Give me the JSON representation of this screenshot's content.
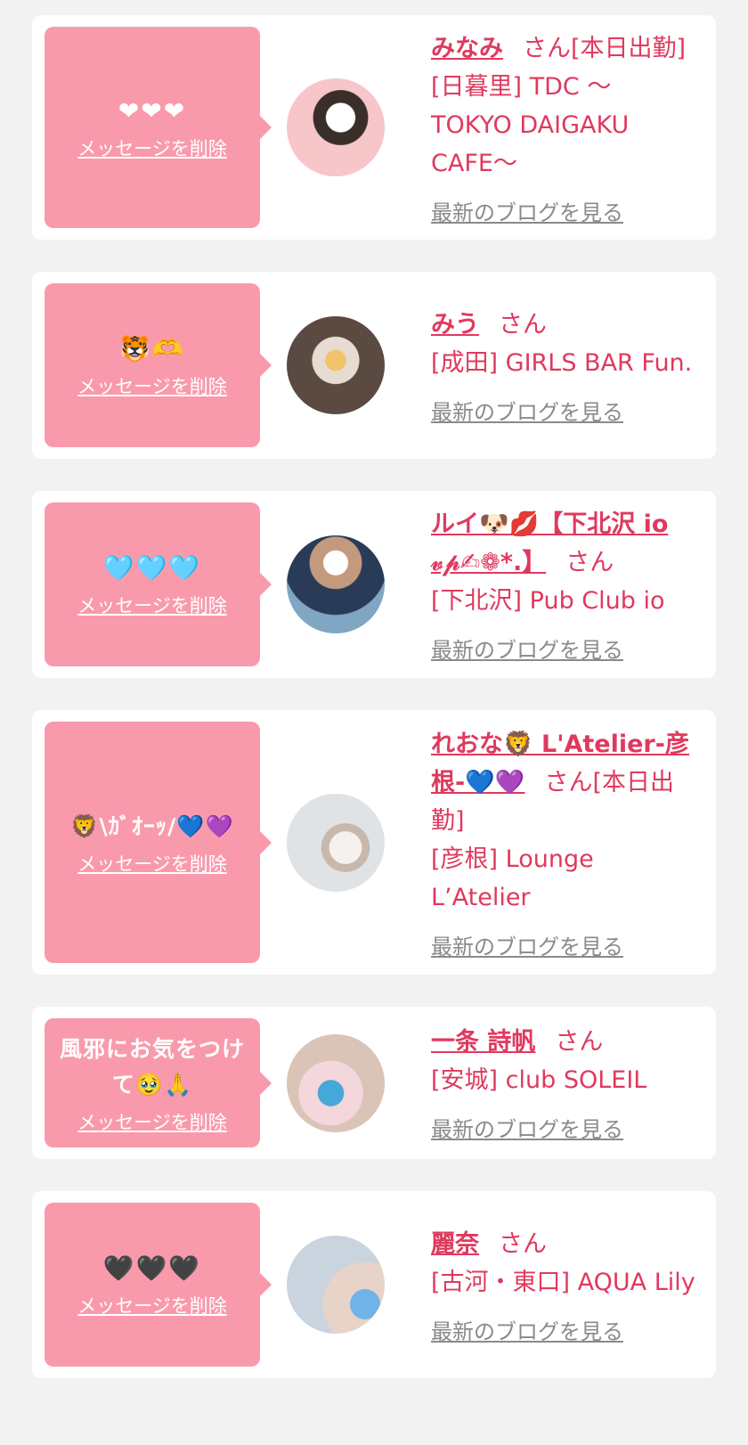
{
  "items": [
    {
      "message": "❤❤❤",
      "delete_label": "メッセージを削除",
      "name": "みなみ",
      "suffix": "さん[本日出勤]",
      "shop": "[日暮里] TDC 〜 TOKYO DAIGAKU CAFE〜",
      "blog_label": "最新のブログを見る",
      "avatar_colors": [
        "#f7c6c9",
        "#e9a3a9"
      ]
    },
    {
      "message": "🐯🫶",
      "delete_label": "メッセージを削除",
      "name": "みう",
      "suffix": "さん",
      "shop": "[成田] GIRLS BAR Fun.",
      "blog_label": "最新のブログを見る",
      "avatar_colors": [
        "#b8a89c",
        "#5b4a42"
      ]
    },
    {
      "message": "🩵🩵🩵",
      "delete_label": "メッセージを削除",
      "name": "ルイ🐶💋【下北沢 io 𝓋𝓅✍︎❁*.】",
      "suffix": "さん",
      "shop": "[下北沢] Pub Club io",
      "blog_label": "最新のブログを見る",
      "avatar_colors": [
        "#7fa6c2",
        "#2a3b57"
      ]
    },
    {
      "message": "🦁\\ｶﾞｵｰｯ/💙💜",
      "delete_label": "メッセージを削除",
      "name": "れおな🦁 L'Atelier-彦根-💙💜",
      "suffix": "さん[本日出勤]",
      "shop": "[彦根] Lounge L’Atelier",
      "blog_label": "最新のブログを見る",
      "avatar_colors": [
        "#dfe3e6",
        "#9aa3aa"
      ]
    },
    {
      "message": "風邪にお気をつけて🥹🙏",
      "delete_label": "メッセージを削除",
      "name": "一条 詩帆",
      "suffix": "さん",
      "shop": "[安城] club SOLEIL",
      "blog_label": "最新のブログを見る",
      "avatar_colors": [
        "#f3d7dc",
        "#46a8d6"
      ]
    },
    {
      "message": "🖤🖤🖤",
      "delete_label": "メッセージを削除",
      "name": "麗奈",
      "suffix": "さん",
      "shop": "[古河・東口] AQUA Lily",
      "blog_label": "最新のブログを見る",
      "avatar_colors": [
        "#c9d4df",
        "#6f7f8f"
      ]
    }
  ]
}
